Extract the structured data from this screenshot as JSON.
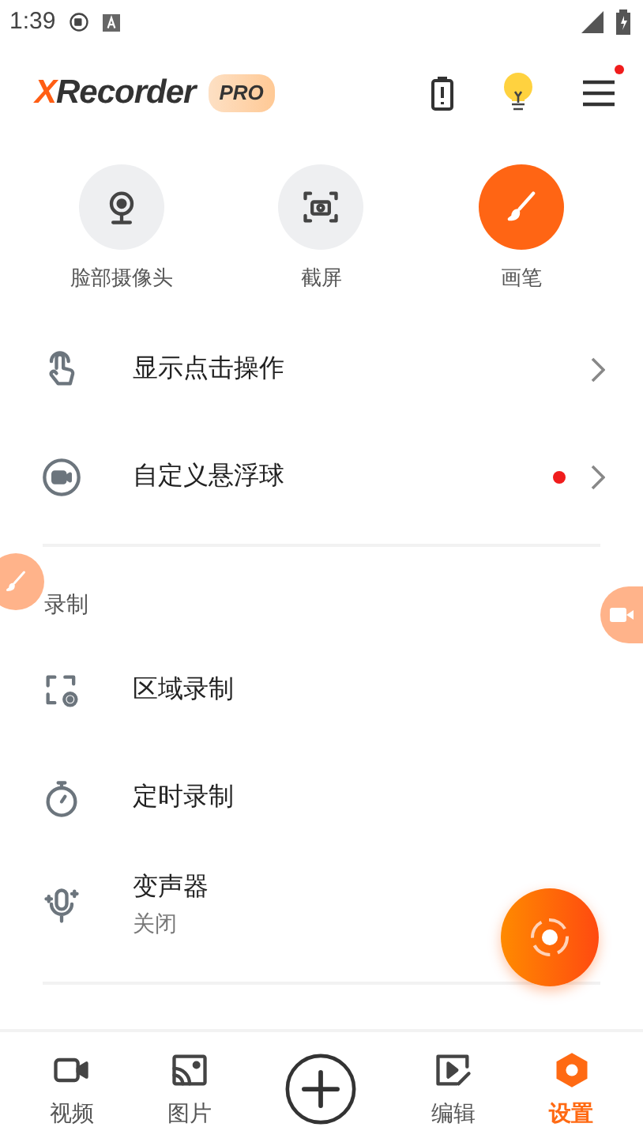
{
  "status_bar": {
    "time": "1:39"
  },
  "header": {
    "logo": {
      "accent": "X",
      "rest": "Recorder"
    },
    "badge": "PRO",
    "menu_notification": true
  },
  "quick_actions": [
    {
      "label": "脸部摄像头",
      "kind": "webcam",
      "active": false
    },
    {
      "label": "截屏",
      "kind": "screenshot",
      "active": false
    },
    {
      "label": "画笔",
      "kind": "brush",
      "active": true
    }
  ],
  "settings": [
    {
      "label": "显示点击操作",
      "kind": "touch",
      "dot": false
    },
    {
      "label": "自定义悬浮球",
      "kind": "bubble",
      "dot": true
    }
  ],
  "section": {
    "title": "录制"
  },
  "recording": [
    {
      "label": "区域录制",
      "kind": "area"
    },
    {
      "label": "定时录制",
      "kind": "timer"
    },
    {
      "label": "变声器",
      "kind": "voice",
      "value": "关闭"
    }
  ],
  "bottom_nav": [
    {
      "label": "视频",
      "kind": "video",
      "selected": false
    },
    {
      "label": "图片",
      "kind": "image",
      "selected": false
    },
    {
      "kind": "add",
      "selected": false
    },
    {
      "label": "编辑",
      "kind": "edit",
      "selected": false
    },
    {
      "label": "设置",
      "kind": "settings",
      "selected": true
    }
  ]
}
